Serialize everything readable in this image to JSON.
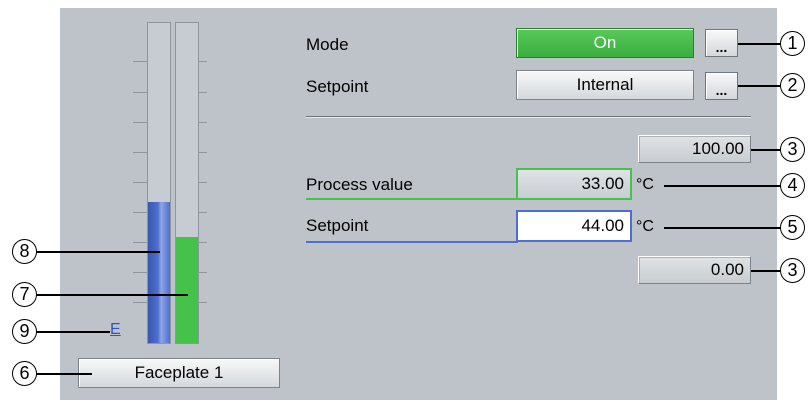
{
  "faceplate": {
    "mode_label": "Mode",
    "mode_value": "On",
    "setpoint_source_label": "Setpoint",
    "setpoint_source_value": "Internal",
    "dots_label": "...",
    "high_limit": "100.00",
    "process_value_label": "Process value",
    "process_value": "33.00",
    "process_value_unit": "°C",
    "setpoint_label": "Setpoint",
    "setpoint_value": "44.00",
    "setpoint_unit": "°C",
    "low_limit": "0.00",
    "bar_marker": "E",
    "name_button": "Faceplate 1"
  },
  "bars": {
    "setpoint_fraction": 0.44,
    "process_value_fraction": 0.33,
    "setpoint_color": "#4d6fcf",
    "process_value_color": "#45c24a"
  },
  "callouts": [
    "1",
    "2",
    "3",
    "4",
    "5",
    "3",
    "6",
    "7",
    "8",
    "9"
  ]
}
